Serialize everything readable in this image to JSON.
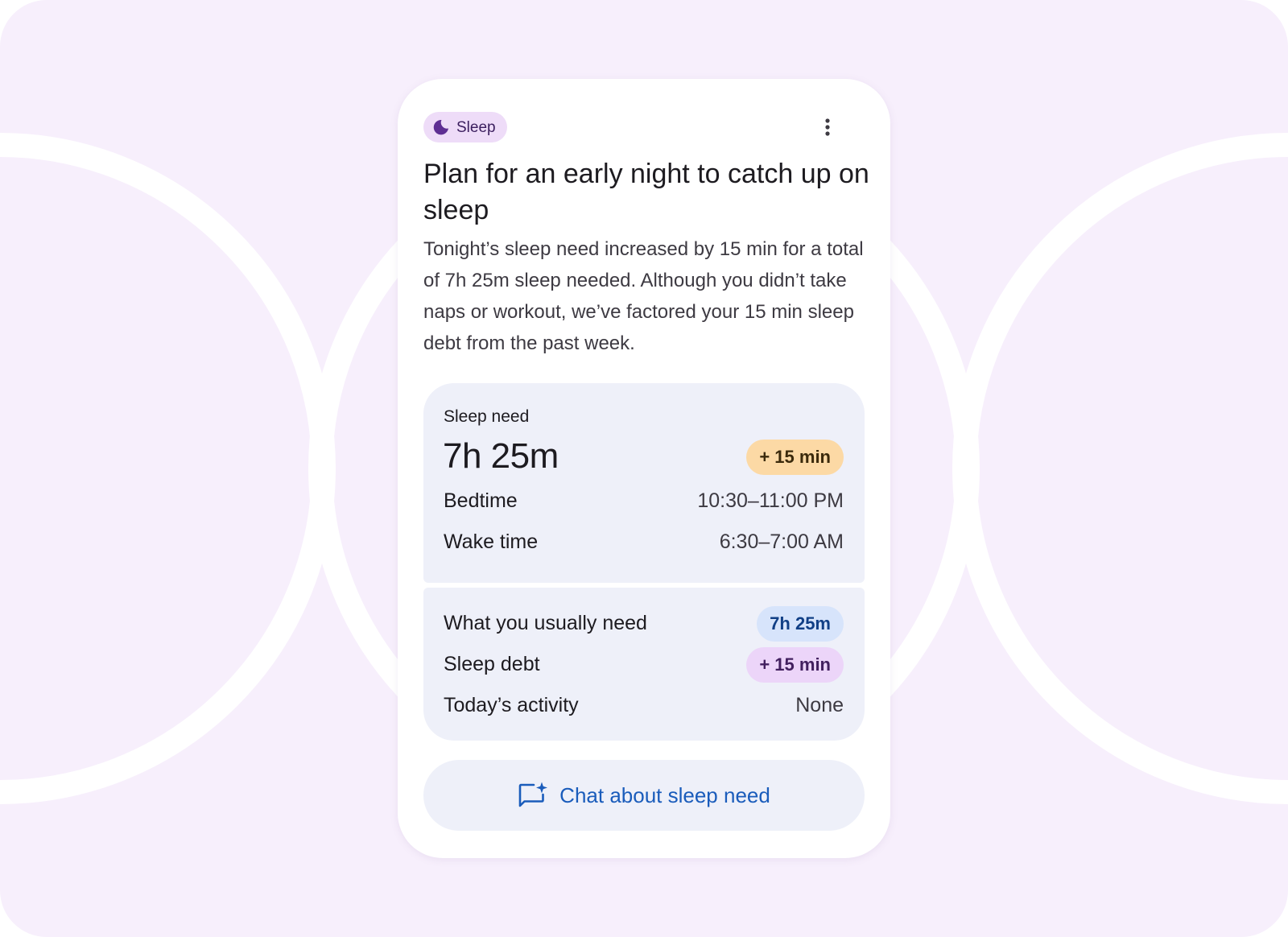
{
  "colors": {
    "background": "#f7effc",
    "card": "#ffffff",
    "panel": "#eef0f9",
    "chip": "#eedcf8",
    "accent_purple": "#5e2e93",
    "accent_blue": "#1a5cbb",
    "pill_orange": "#fcd9a5",
    "pill_blue": "#d7e4fb",
    "pill_purple": "#ecd5f9"
  },
  "chip": {
    "icon": "moon-icon",
    "label": "Sleep"
  },
  "menu": {
    "icon": "more-vert-icon"
  },
  "title": "Plan for an early night to catch up on sleep",
  "description": "Tonight’s sleep need increased by 15 min for a total of 7h 25m sleep needed. Although you didn’t take naps or workout, we’ve factored your 15 min sleep debt from the past week.",
  "sleep_need": {
    "label": "Sleep need",
    "value": "7h 25m",
    "change": "+ 15 min",
    "rows": [
      {
        "label": "Bedtime",
        "value": "10:30–11:00 PM"
      },
      {
        "label": "Wake time",
        "value": "6:30–7:00 AM"
      }
    ]
  },
  "breakdown": {
    "usual_need": {
      "label": "What you usually need",
      "value": "7h 25m"
    },
    "sleep_debt": {
      "label": "Sleep debt",
      "value": "+ 15 min"
    },
    "activity": {
      "label": "Today’s activity",
      "value": "None"
    }
  },
  "chat_button": {
    "icon": "chat-sparkle-icon",
    "label": "Chat about sleep need"
  }
}
